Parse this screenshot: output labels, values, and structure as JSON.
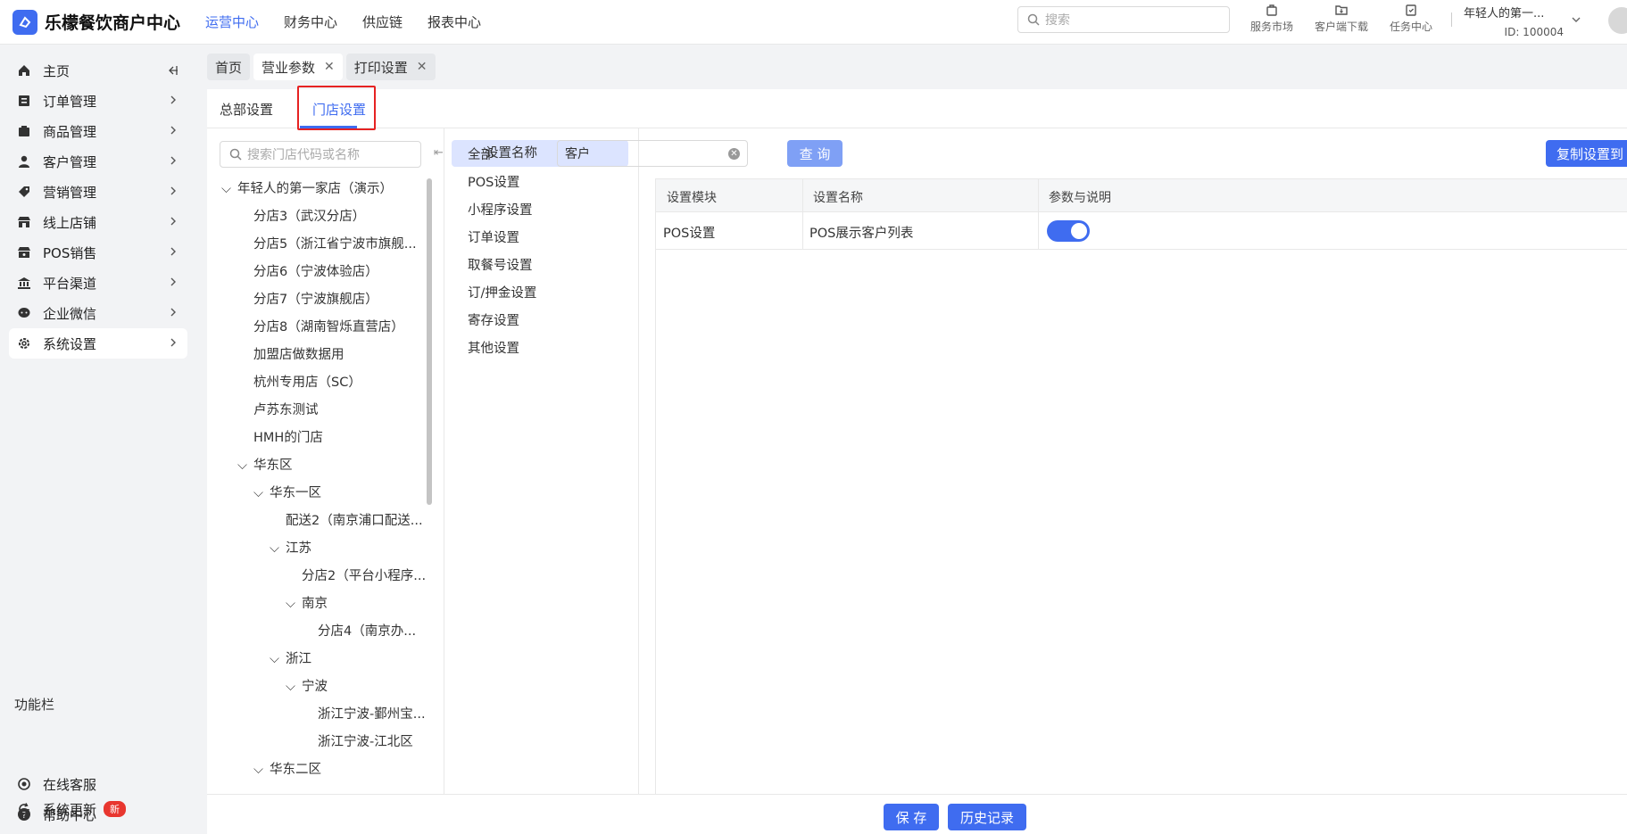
{
  "app": {
    "title": "乐檬餐饮商户中心",
    "topnav": [
      "运营中心",
      "财务中心",
      "供应链",
      "报表中心"
    ],
    "search_placeholder": "搜索",
    "tools": [
      "服务市场",
      "客户端下载",
      "任务中心"
    ],
    "account_name": "年轻人的第一...",
    "account_id": "ID: 100004"
  },
  "sidebar": {
    "items": [
      {
        "label": "主页",
        "icon": "home-icon"
      },
      {
        "label": "订单管理",
        "icon": "order-icon"
      },
      {
        "label": "商品管理",
        "icon": "product-icon"
      },
      {
        "label": "客户管理",
        "icon": "user-icon"
      },
      {
        "label": "营销管理",
        "icon": "tag-icon"
      },
      {
        "label": "线上店铺",
        "icon": "store-icon"
      },
      {
        "label": "POS销售",
        "icon": "pos-icon"
      },
      {
        "label": "平台渠道",
        "icon": "bank-icon"
      },
      {
        "label": "企业微信",
        "icon": "chat-icon"
      },
      {
        "label": "系统设置",
        "icon": "gear-icon"
      }
    ],
    "section_title": "功能栏",
    "bottom": [
      {
        "label": "在线客服",
        "icon": "service-icon"
      },
      {
        "label": "帮助中心",
        "icon": "help-icon"
      },
      {
        "label": "系统更新",
        "icon": "refresh-icon",
        "badge": "新"
      }
    ]
  },
  "tabs": [
    {
      "label": "首页",
      "closable": false
    },
    {
      "label": "营业参数",
      "closable": true
    },
    {
      "label": "打印设置",
      "closable": true
    }
  ],
  "subtabs": [
    "总部设置",
    "门店设置"
  ],
  "tree": {
    "search_placeholder": "搜索门店代码或名称",
    "nodes": [
      "年轻人的第一家店（演示）",
      "分店3（武汉分店）",
      "分店5（浙江省宁波市旗舰...",
      "分店6（宁波体验店）",
      "分店7（宁波旗舰店）",
      "分店8（湖南智烁直营店）",
      "加盟店做数据用",
      "杭州专用店（SC）",
      "卢苏东测试",
      "HMH的门店",
      "华东区",
      "华东一区",
      "配送2（南京浦口配送...",
      "江苏",
      "分店2（平台小程序...",
      "南京",
      "分店4（南京办...",
      "浙江",
      "宁波",
      "浙江宁波-鄞州宝...",
      "浙江宁波-江北区",
      "华东二区"
    ]
  },
  "categories": [
    "全部",
    "POS设置",
    "小程序设置",
    "订单设置",
    "取餐号设置",
    "订/押金设置",
    "寄存设置",
    "其他设置"
  ],
  "filter": {
    "label": "设置名称",
    "value": "客户",
    "query_button": "查 询",
    "copy_button": "复制设置到"
  },
  "table": {
    "headers": [
      "设置模块",
      "设置名称",
      "参数与说明"
    ],
    "rows": [
      {
        "module": "POS设置",
        "name": "POS展示客户列表",
        "enabled": true
      }
    ]
  },
  "footer": {
    "save": "保 存",
    "history": "历史记录"
  },
  "colors": {
    "primary": "#3f6cf0",
    "highlight_box": "#e62222",
    "badge": "#e8362f"
  }
}
